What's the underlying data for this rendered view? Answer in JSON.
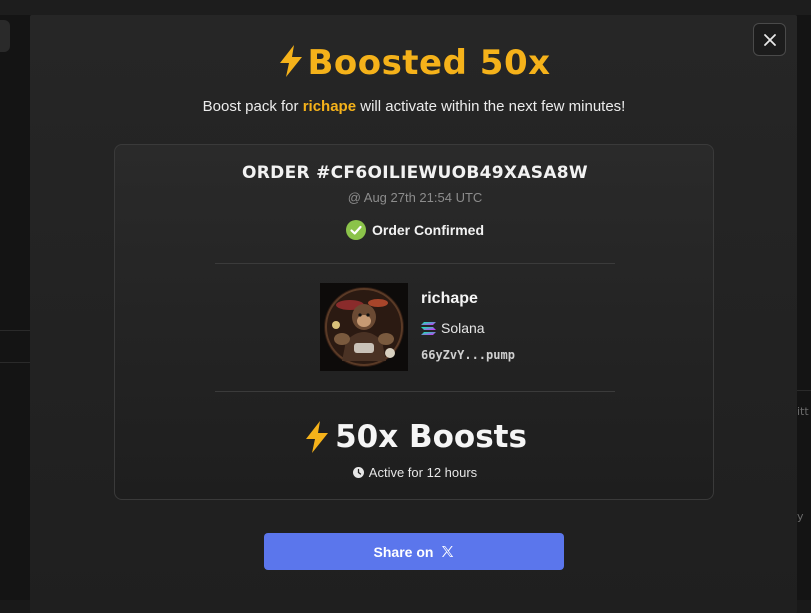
{
  "modal": {
    "title": "Boosted 50x",
    "subtitle_prefix": "Boost pack for ",
    "subtitle_token": "richape",
    "subtitle_suffix": " will activate within the next few minutes!",
    "close_icon": "close-icon"
  },
  "order": {
    "id": "ORDER #CF6OILIEWUOB49XASA8W",
    "date": "@ Aug 27th 21:54 UTC",
    "status": "Order Confirmed",
    "status_icon": "check-circle-icon",
    "status_color": "#8bc34a"
  },
  "token": {
    "name": "richape",
    "chain": "Solana",
    "chain_icon": "solana-icon",
    "address": "66yZvY...pump"
  },
  "boost": {
    "label": "50x Boosts",
    "icon": "lightning-icon",
    "duration": "Active for 12 hours",
    "duration_icon": "clock-icon"
  },
  "share": {
    "label": "Share on",
    "icon": "x-logo-icon",
    "color": "#5b76ec"
  },
  "colors": {
    "accent": "#f5b21a",
    "modal_bg": "#232323",
    "card_border": "#3a3a3a"
  }
}
